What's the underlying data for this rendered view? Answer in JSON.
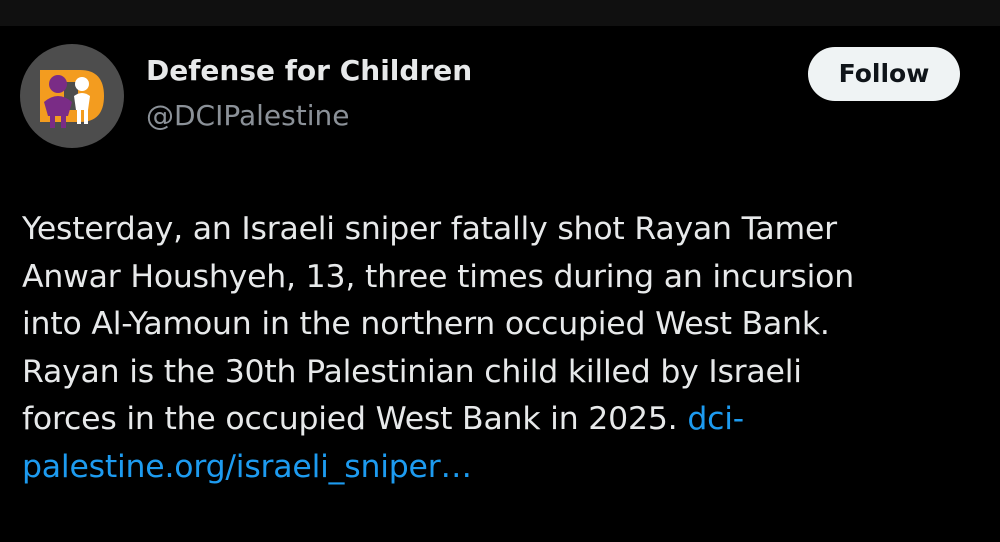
{
  "account": {
    "display_name": "Defense for Children",
    "handle": "@DCIPalestine",
    "follow_label": "Follow"
  },
  "tweet": {
    "lines": [
      "Yesterday, an Israeli sniper fatally shot Rayan Tamer",
      "Anwar Houshyeh, 13, three times during an incursion",
      "into Al-Yamoun in the northern occupied West Bank.",
      "Rayan is the 30th Palestinian child killed by Israeli",
      "forces in the occupied West Bank in 2025. "
    ],
    "link_line_1": "dci-",
    "link_line_2": "palestine.org/israeli_sniper…"
  },
  "colors": {
    "background": "#000000",
    "text": "#e7e9ea",
    "secondary_text": "#8b9198",
    "link": "#1d9bf0",
    "follow_button_bg": "#eff3f4",
    "logo_orange": "#f39c1f",
    "logo_purple": "#7a2c86"
  },
  "icons": {
    "avatar": "dci-logo-icon"
  }
}
